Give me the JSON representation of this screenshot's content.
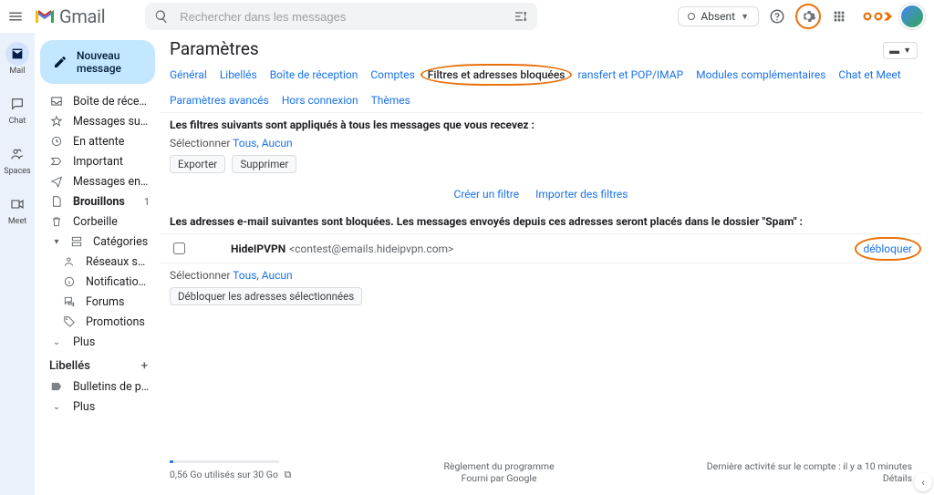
{
  "header": {
    "logo_text": "Gmail",
    "search_placeholder": "Rechercher dans les messages",
    "absent_label": "Absent",
    "input_split": "▬ ▾"
  },
  "strip": {
    "mail": "Mail",
    "chat": "Chat",
    "spaces": "Spaces",
    "meet": "Meet"
  },
  "sidebar": {
    "compose": "Nouveau message",
    "inbox": "Boîte de réception",
    "starred": "Messages suivis",
    "snoozed": "En attente",
    "important": "Important",
    "sent": "Messages envoyés",
    "drafts": "Brouillons",
    "drafts_count": "1",
    "trash": "Corbeille",
    "categories": "Catégories",
    "social": "Réseaux sociaux",
    "updates": "Notifications",
    "forums": "Forums",
    "promotions": "Promotions",
    "more": "Plus",
    "labels_header": "Libellés",
    "label1": "Bulletins de paie",
    "more2": "Plus"
  },
  "page": {
    "title": "Paramètres",
    "tabs": {
      "general": "Général",
      "labels": "Libellés",
      "inbox": "Boîte de réception",
      "accounts": "Comptes",
      "filters": "Filtres et adresses bloquées",
      "fwd": "ransfert et POP/IMAP",
      "addons": "Modules complémentaires",
      "chat": "Chat et Meet",
      "advanced": "Paramètres avancés",
      "offline": "Hors connexion",
      "themes": "Thèmes"
    },
    "filters_header": "Les filtres suivants sont appliqués à tous les messages que vous recevez :",
    "select_label": "Sélectionner",
    "all": "Tous",
    "none": "Aucun",
    "export": "Exporter",
    "delete": "Supprimer",
    "create_filter": "Créer un filtre",
    "import_filters": "Importer des filtres",
    "blocked_header": "Les adresses e-mail suivantes sont bloquées. Les messages envoyés depuis ces adresses seront placés dans le dossier \"Spam\" :",
    "blocked_name": "HideIPVPN",
    "blocked_addr": "<contest@emails.hideipvpn.com>",
    "unblock": "débloquer",
    "unblock_selected": "Débloquer les adresses sélectionnées",
    "select_label2": "Sélectionner",
    "all2": "Tous",
    "none2": "Aucun"
  },
  "footer": {
    "storage": "0,56 Go utilisés sur 30 Go",
    "rules": "Règlement du programme",
    "powered": "Fourni par Google",
    "activity": "Dernière activité sur le compte : il y a 10 minutes",
    "details": "Détails"
  }
}
